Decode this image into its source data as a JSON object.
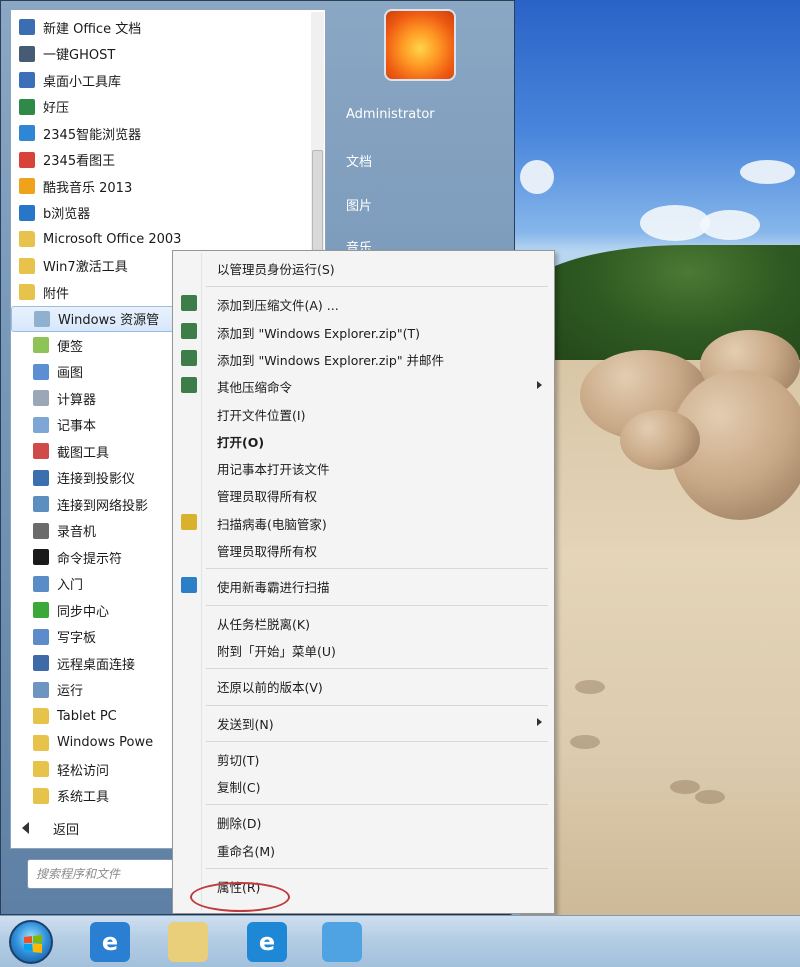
{
  "colors": {
    "start_menu_panel": "#6f90b2",
    "context_menu_bg": "#f4f4f4",
    "highlight_circle": "#c0393b",
    "taskbar": "#b4cde4"
  },
  "start_menu": {
    "programs": [
      {
        "label": "新建 Office 文档",
        "icon": "office-doc-icon",
        "color": "#3b6db3",
        "level": 0
      },
      {
        "label": "一键GHOST",
        "icon": "ghost-icon",
        "color": "#475b74",
        "level": 0
      },
      {
        "label": "桌面小工具库",
        "icon": "gadgets-icon",
        "color": "#3b6fb8",
        "level": 0
      },
      {
        "label": "好压",
        "icon": "haozip-icon",
        "color": "#2f8a4a",
        "level": 0
      },
      {
        "label": "2345智能浏览器",
        "icon": "browser-2345-icon",
        "color": "#2e86d4",
        "level": 0
      },
      {
        "label": "2345看图王",
        "icon": "image-viewer-icon",
        "color": "#d8443a",
        "level": 0
      },
      {
        "label": "酷我音乐 2013",
        "icon": "kuwo-music-icon",
        "color": "#f1a21b",
        "level": 0
      },
      {
        "label": "b浏览器",
        "icon": "b-browser-icon",
        "color": "#2776c9",
        "level": 0
      },
      {
        "label": "Microsoft Office 2003",
        "icon": "folder-icon",
        "color": "#e8c34c",
        "level": 0
      },
      {
        "label": "Win7激活工具",
        "icon": "folder-icon",
        "color": "#e8c34c",
        "level": 0
      },
      {
        "label": "附件",
        "icon": "folder-icon",
        "color": "#e8c34c",
        "level": 0
      },
      {
        "label": "Windows 资源管",
        "icon": "explorer-icon",
        "color": "#8fb0cf",
        "level": 1,
        "selected": true
      },
      {
        "label": "便签",
        "icon": "sticky-notes-icon",
        "color": "#8dc357",
        "level": 1
      },
      {
        "label": "画图",
        "icon": "paint-icon",
        "color": "#5c8fd1",
        "level": 1
      },
      {
        "label": "计算器",
        "icon": "calculator-icon",
        "color": "#9aa7b6",
        "level": 1
      },
      {
        "label": "记事本",
        "icon": "notepad-icon",
        "color": "#7ea7d6",
        "level": 1
      },
      {
        "label": "截图工具",
        "icon": "snipping-tool-icon",
        "color": "#d04a4a",
        "level": 1
      },
      {
        "label": "连接到投影仪",
        "icon": "projector-icon",
        "color": "#3c6fb0",
        "level": 1
      },
      {
        "label": "连接到网络投影",
        "icon": "network-projector-icon",
        "color": "#5d8ec0",
        "level": 1
      },
      {
        "label": "录音机",
        "icon": "recorder-icon",
        "color": "#6b6b6b",
        "level": 1
      },
      {
        "label": "命令提示符",
        "icon": "cmd-icon",
        "color": "#1a1a1a",
        "level": 1
      },
      {
        "label": "入门",
        "icon": "getting-started-icon",
        "color": "#5a8cc7",
        "level": 1
      },
      {
        "label": "同步中心",
        "icon": "sync-center-icon",
        "color": "#3ca83a",
        "level": 1
      },
      {
        "label": "写字板",
        "icon": "wordpad-icon",
        "color": "#5c8cc9",
        "level": 1
      },
      {
        "label": "远程桌面连接",
        "icon": "remote-desktop-icon",
        "color": "#3e6aa8",
        "level": 1
      },
      {
        "label": "运行",
        "icon": "run-icon",
        "color": "#6e95c2",
        "level": 1
      },
      {
        "label": "Tablet PC",
        "icon": "folder-icon",
        "color": "#e8c34c",
        "level": 1
      },
      {
        "label": "Windows Powe",
        "icon": "folder-icon",
        "color": "#e8c34c",
        "level": 1
      },
      {
        "label": "轻松访问",
        "icon": "folder-icon",
        "color": "#e8c34c",
        "level": 1
      },
      {
        "label": "系统工具",
        "icon": "folder-icon",
        "color": "#e8c34c",
        "level": 1
      }
    ],
    "back_label": "返回",
    "search_placeholder": "搜索程序和文件",
    "right_links": [
      "Administrator",
      "文档",
      "图片",
      "音乐"
    ]
  },
  "context_menu": {
    "items": [
      {
        "label": "以管理员身份运行(S)",
        "icon": "",
        "type": "item"
      },
      {
        "type": "separator"
      },
      {
        "label": "添加到压缩文件(A) ...",
        "icon": "archive-icon",
        "color": "#3d7d4a",
        "type": "item"
      },
      {
        "label": "添加到 \"Windows Explorer.zip\"(T)",
        "icon": "archive-icon",
        "color": "#3d7d4a",
        "type": "item"
      },
      {
        "label": "添加到 \"Windows Explorer.zip\" 并邮件",
        "icon": "archive-icon",
        "color": "#3d7d4a",
        "type": "item"
      },
      {
        "label": "其他压缩命令",
        "icon": "archive-icon",
        "color": "#3d7d4a",
        "type": "item",
        "submenu": true
      },
      {
        "label": "打开文件位置(I)",
        "icon": "",
        "type": "item"
      },
      {
        "label": "打开(O)",
        "icon": "",
        "type": "item",
        "bold": true
      },
      {
        "label": "用记事本打开该文件",
        "icon": "",
        "type": "item"
      },
      {
        "label": "管理员取得所有权",
        "icon": "",
        "type": "item"
      },
      {
        "label": "扫描病毒(电脑管家)",
        "icon": "shield-icon",
        "color": "#d8b22c",
        "type": "item"
      },
      {
        "label": "管理员取得所有权",
        "icon": "",
        "type": "item"
      },
      {
        "type": "separator"
      },
      {
        "label": "使用新毒霸进行扫描",
        "icon": "antivirus-icon",
        "color": "#2a7fc6",
        "type": "item"
      },
      {
        "type": "separator"
      },
      {
        "label": "从任务栏脱离(K)",
        "icon": "",
        "type": "item"
      },
      {
        "label": "附到「开始」菜单(U)",
        "icon": "",
        "type": "item"
      },
      {
        "type": "separator"
      },
      {
        "label": "还原以前的版本(V)",
        "icon": "",
        "type": "item"
      },
      {
        "type": "separator"
      },
      {
        "label": "发送到(N)",
        "icon": "",
        "type": "item",
        "submenu": true
      },
      {
        "type": "separator"
      },
      {
        "label": "剪切(T)",
        "icon": "",
        "type": "item"
      },
      {
        "label": "复制(C)",
        "icon": "",
        "type": "item"
      },
      {
        "type": "separator"
      },
      {
        "label": "删除(D)",
        "icon": "",
        "type": "item"
      },
      {
        "label": "重命名(M)",
        "icon": "",
        "type": "item"
      },
      {
        "type": "separator"
      },
      {
        "label": "属性(R)",
        "icon": "",
        "type": "item",
        "highlighted": true
      }
    ]
  },
  "taskbar": {
    "apps": [
      {
        "icon": "internet-explorer-icon",
        "glyph": "e",
        "color": "#2b7fd3"
      },
      {
        "icon": "file-explorer-icon",
        "glyph": "",
        "color": "#e9cf7a"
      },
      {
        "icon": "ie-browser-icon",
        "glyph": "e",
        "color": "#1e88d6"
      },
      {
        "icon": "app-icon",
        "glyph": "",
        "color": "#4fa3e3"
      }
    ]
  }
}
